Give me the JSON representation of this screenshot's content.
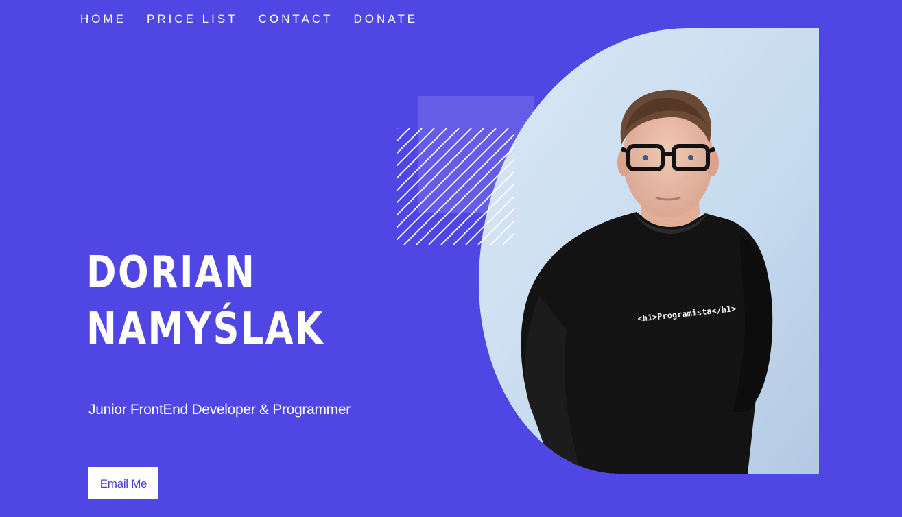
{
  "nav": {
    "items": [
      "HOME",
      "PRICE LIST",
      "CONTACT",
      "DONATE"
    ]
  },
  "hero": {
    "name_line1": "DORIAN",
    "name_line2": "NAMYŚLAK",
    "tagline": "Junior FrontEnd Developer & Programmer",
    "cta_label": "Email Me"
  },
  "photo": {
    "shirt_text": "<h1>Programista</h1>"
  },
  "colors": {
    "background": "#5046e4",
    "button_text": "#4a3fd8",
    "text": "#ffffff"
  },
  "icons": [
    "diagonal-stripes-decoration",
    "translucent-square-decoration"
  ]
}
